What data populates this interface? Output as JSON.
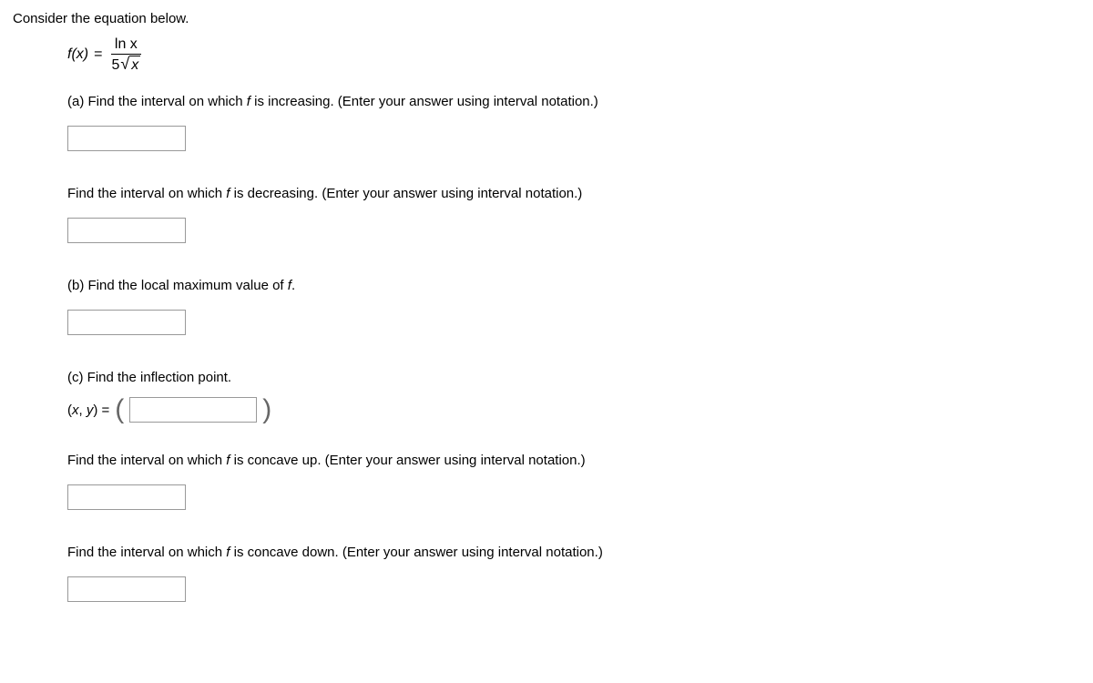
{
  "intro": "Consider the equation below.",
  "equation": {
    "lhs": "f(x)",
    "eq": "=",
    "numerator_label": "ln x",
    "denominator_coeff": "5",
    "radicand": "x"
  },
  "parts": {
    "a_inc": "(a) Find the interval on which f is increasing. (Enter your answer using interval notation.)",
    "a_dec": "Find the interval on which f is decreasing. (Enter your answer using interval notation.)",
    "b": "(b) Find the local maximum value of f.",
    "c": "(c) Find the inflection point.",
    "c_point_label": "(x, y) = ",
    "c_up": "Find the interval on which f is concave up. (Enter your answer using interval notation.)",
    "c_down": "Find the interval on which f is concave down. (Enter your answer using interval notation.)"
  }
}
